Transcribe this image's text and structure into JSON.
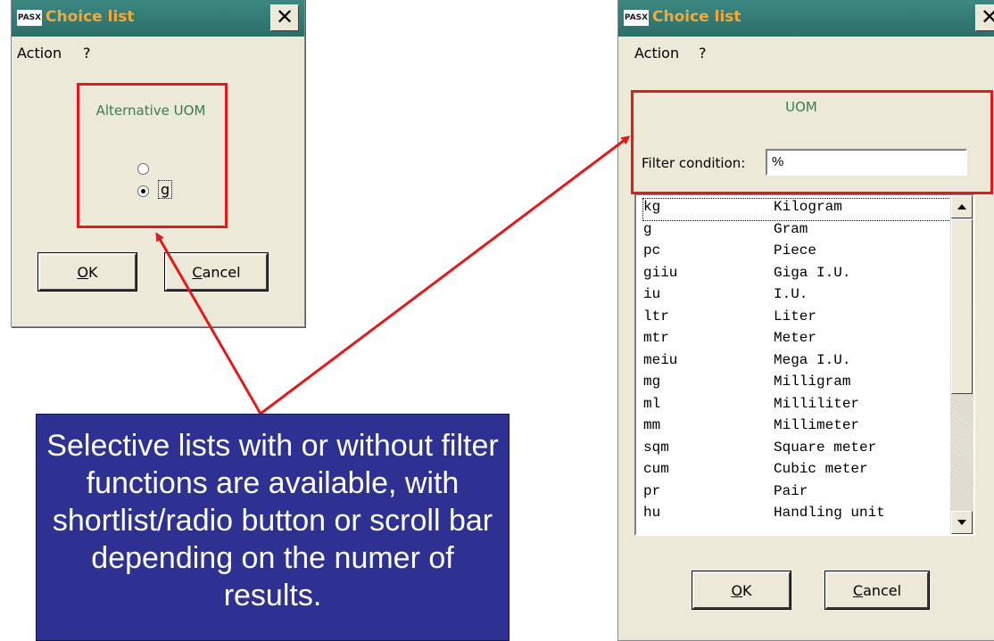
{
  "left_dialog": {
    "logo": "PASX",
    "title": "Choice list",
    "close_symbol": "✕",
    "menu": [
      "Action",
      "?"
    ],
    "group_label": "Alternative UOM",
    "radio_options": [
      {
        "label": "",
        "checked": false
      },
      {
        "label": "g",
        "checked": true
      }
    ],
    "ok_label": "OK",
    "cancel_label": "Cancel"
  },
  "right_dialog": {
    "logo": "PASX",
    "title": "Choice list",
    "close_symbol": "✕",
    "menu": [
      "Action",
      "?"
    ],
    "group_label": "UOM",
    "filter_label": "Filter condition:",
    "filter_value": "%",
    "list_items": [
      {
        "code": "kg",
        "name": "Kilogram"
      },
      {
        "code": "g",
        "name": "Gram"
      },
      {
        "code": "pc",
        "name": "Piece"
      },
      {
        "code": "giiu",
        "name": "Giga I.U."
      },
      {
        "code": "iu",
        "name": "I.U."
      },
      {
        "code": "ltr",
        "name": "Liter"
      },
      {
        "code": "mtr",
        "name": "Meter"
      },
      {
        "code": "meiu",
        "name": "Mega I.U."
      },
      {
        "code": "mg",
        "name": "Milligram"
      },
      {
        "code": "ml",
        "name": "Milliliter"
      },
      {
        "code": "mm",
        "name": "Millimeter"
      },
      {
        "code": "sqm",
        "name": "Square meter"
      },
      {
        "code": "cum",
        "name": "Cubic meter"
      },
      {
        "code": "pr",
        "name": "Pair"
      },
      {
        "code": "hu",
        "name": "Handling unit"
      }
    ],
    "ok_label": "OK",
    "cancel_label": "Cancel"
  },
  "callout_text": "Selective lists with or without filter functions are available, with shortlist/radio button or scroll bar depending on the numer of results.",
  "colors": {
    "title_bar": "#2c6f69",
    "title_text": "#f2a93b",
    "highlight_box": "#e21a1a",
    "callout_bg": "#2e3192",
    "group_label_green": "#3d7a55"
  }
}
